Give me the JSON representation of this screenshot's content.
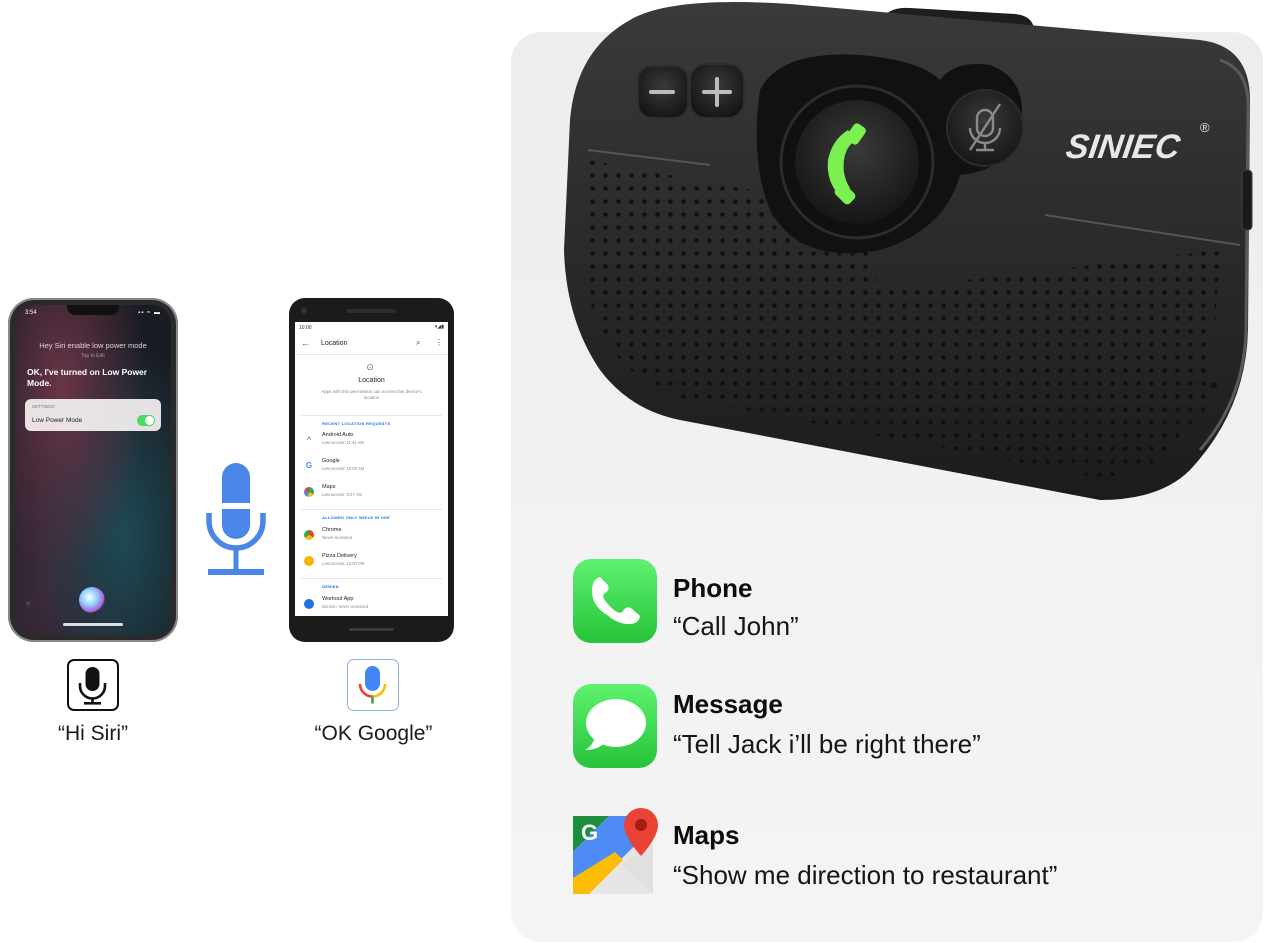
{
  "iphone": {
    "time": "3:54",
    "status": "▪▪ ≈ ▬",
    "prompt": "Hey Siri enable low power mode",
    "tap_to_edit": "Tap to Edit",
    "reply": "OK, I've turned on Low Power Mode.",
    "card_header": "SETTINGS",
    "card_setting": "Low Power Mode",
    "toggle_on": true
  },
  "android": {
    "time": "10:00",
    "status": "▾◢▮",
    "app_bar_title": "Location",
    "page_heading": "Location",
    "page_description": "Apps with this permission can access this device's location",
    "sections": [
      {
        "header": "RECENT LOCATION REQUESTS",
        "items": [
          {
            "name": "Android Auto",
            "sub": "Last access: 11:41 AM",
            "color": "#5f6368"
          },
          {
            "name": "Google",
            "sub": "Last access: 10:02 AM",
            "color": "#4285f4"
          },
          {
            "name": "Maps",
            "sub": "Last access: 9:37 AM",
            "color": "#34a853"
          }
        ]
      },
      {
        "header": "ALLOWED ONLY WHILE IN USE",
        "items": [
          {
            "name": "Chrome",
            "sub": "Never accessed",
            "color": "#ea4335"
          },
          {
            "name": "Pizza Delivery",
            "sub": "Last access: 12:00 PM",
            "color": "#f4b400"
          }
        ]
      },
      {
        "header": "DENIED",
        "items": [
          {
            "name": "Workout App",
            "sub": "Denied / never accessed",
            "color": "#1a73e8"
          }
        ]
      }
    ]
  },
  "labels": {
    "siri_caption": "“Hi Siri”",
    "google_caption": "“OK Google”"
  },
  "device": {
    "brand": "SINIEC",
    "registered_mark": "®",
    "minus": "−",
    "plus": "+"
  },
  "features": [
    {
      "name": "Phone",
      "quote": "“Call John”",
      "icon": "phone-app-icon"
    },
    {
      "name": "Message",
      "quote": "“Tell Jack i’ll be right there”",
      "icon": "messages-app-icon"
    },
    {
      "name": "Maps",
      "quote": "“Show me direction to restaurant”",
      "icon": "google-maps-icon"
    }
  ],
  "colors": {
    "mic_blue": "#4a86e8",
    "call_green": "#7cf050",
    "ios_green": "#34c759"
  }
}
